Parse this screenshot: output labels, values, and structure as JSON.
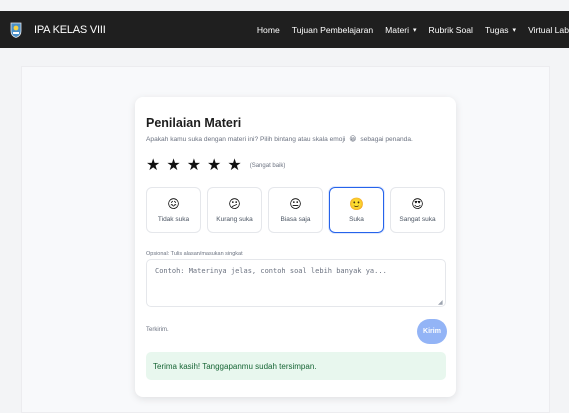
{
  "navbar": {
    "brand_title": "IPA KELAS VIII",
    "links": [
      {
        "label": "Home",
        "has_caret": false
      },
      {
        "label": "Tujuan Pembelajaran",
        "has_caret": false
      },
      {
        "label": "Materi",
        "has_caret": true
      },
      {
        "label": "Rubrik Soal",
        "has_caret": false
      },
      {
        "label": "Tugas",
        "has_caret": true
      },
      {
        "label": "Virtual Lab",
        "has_caret": false
      }
    ],
    "caret_glyph": "▾",
    "background": "#1f1f1f"
  },
  "card": {
    "title": "Penilaian Materi",
    "subtitle_before": "Apakah kamu suka dengan materi ini? Pilih bintang atau skala emoji",
    "subtitle_emoji": "😀",
    "subtitle_after": "sebagai penanda.",
    "stars": {
      "filled": 5,
      "total": 5,
      "glyph": "★"
    },
    "rating_label": "(Sangat baik)",
    "emoji_options": [
      {
        "emoji": "😖",
        "label": "Tidak suka",
        "selected": false
      },
      {
        "emoji": "😕",
        "label": "Kurang suka",
        "selected": false
      },
      {
        "emoji": "😐",
        "label": "Biasa saja",
        "selected": false
      },
      {
        "emoji": "🙂",
        "label": "Suka",
        "selected": true
      },
      {
        "emoji": "😍",
        "label": "Sangat suka",
        "selected": false
      }
    ],
    "comment_label": "Opsional: Tulis alasan/masukan singkat",
    "comment_placeholder": "Contoh: Materinya jelas, contoh soal lebih banyak ya...",
    "comment_value": "",
    "status_text": "Terkirim.",
    "send_label": "Kirim",
    "success_message": "Terima kasih! Tanggapanmu sudah tersimpan."
  },
  "colors": {
    "accent": "#2563eb",
    "send_button": "#93b4f6",
    "success_bg": "#e8f7ee",
    "success_text": "#166534"
  }
}
